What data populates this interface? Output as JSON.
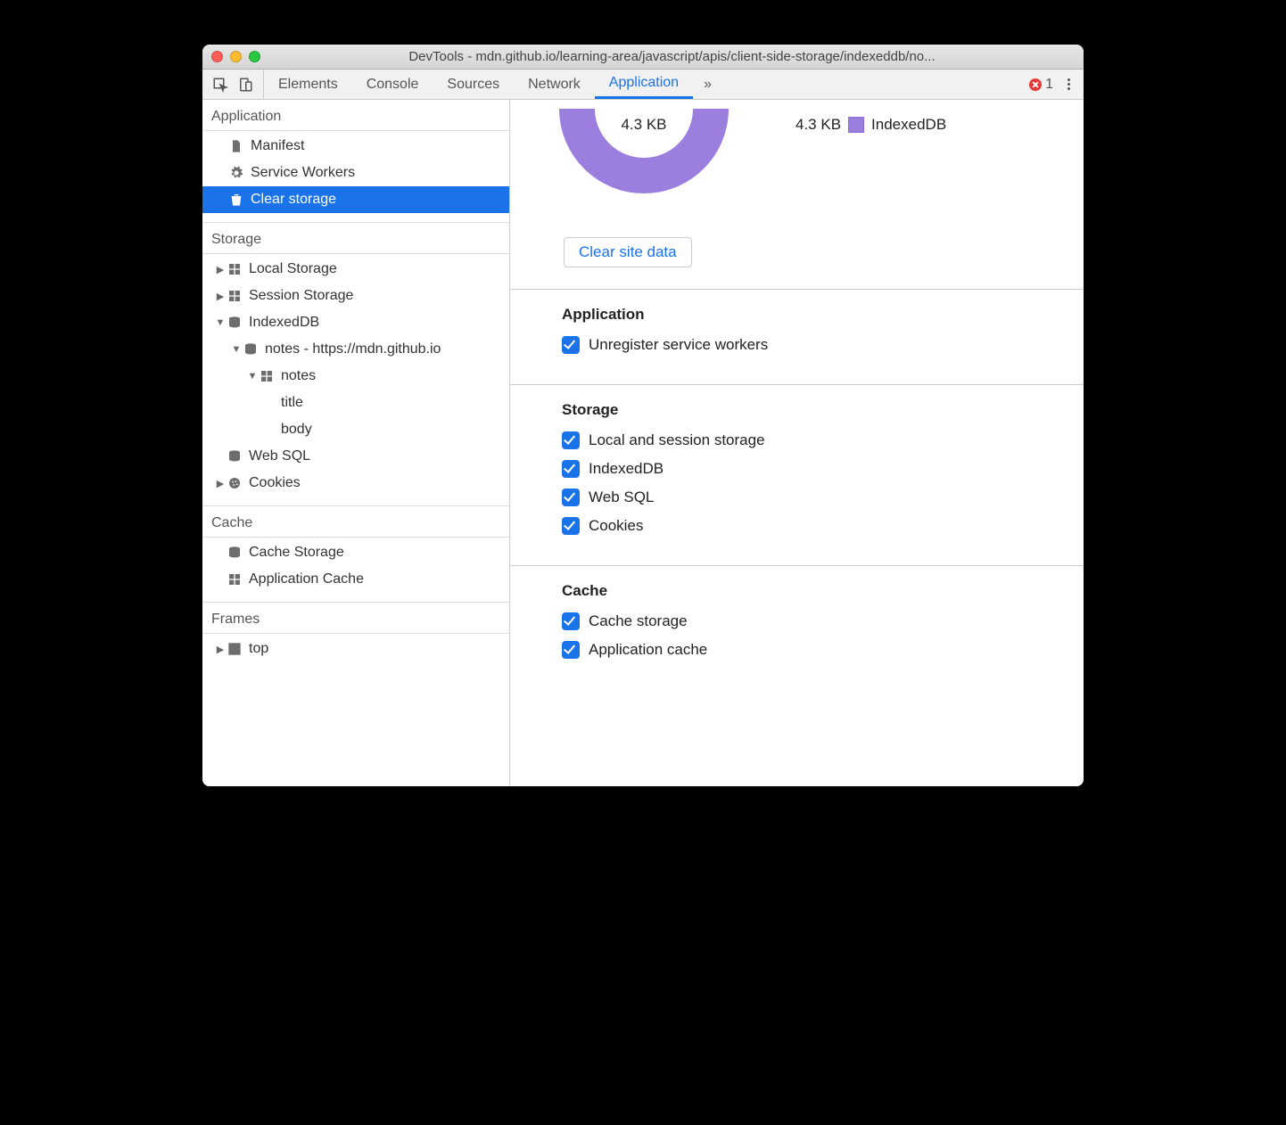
{
  "window": {
    "title": "DevTools - mdn.github.io/learning-area/javascript/apis/client-side-storage/indexeddb/no..."
  },
  "tabbar": {
    "tabs": [
      "Elements",
      "Console",
      "Sources",
      "Network",
      "Application"
    ],
    "active": "Application",
    "more": "»",
    "errors": "1"
  },
  "sidebar": {
    "application": {
      "header": "Application",
      "items": [
        "Manifest",
        "Service Workers",
        "Clear storage"
      ],
      "selected": "Clear storage"
    },
    "storage": {
      "header": "Storage",
      "localStorage": "Local Storage",
      "sessionStorage": "Session Storage",
      "indexedDB": "IndexedDB",
      "idb_db": "notes - https://mdn.github.io",
      "idb_store": "notes",
      "idb_col1": "title",
      "idb_col2": "body",
      "webSQL": "Web SQL",
      "cookies": "Cookies"
    },
    "cache": {
      "header": "Cache",
      "cacheStorage": "Cache Storage",
      "appCache": "Application Cache"
    },
    "frames": {
      "header": "Frames",
      "top": "top"
    }
  },
  "main": {
    "donut_center": "4.3 KB",
    "legend_value": "4.3 KB",
    "legend_label": "IndexedDB",
    "donut_color": "#9b7ede",
    "clear_button": "Clear site data",
    "groups": {
      "application": {
        "title": "Application",
        "items": [
          "Unregister service workers"
        ]
      },
      "storage": {
        "title": "Storage",
        "items": [
          "Local and session storage",
          "IndexedDB",
          "Web SQL",
          "Cookies"
        ]
      },
      "cache": {
        "title": "Cache",
        "items": [
          "Cache storage",
          "Application cache"
        ]
      }
    }
  }
}
